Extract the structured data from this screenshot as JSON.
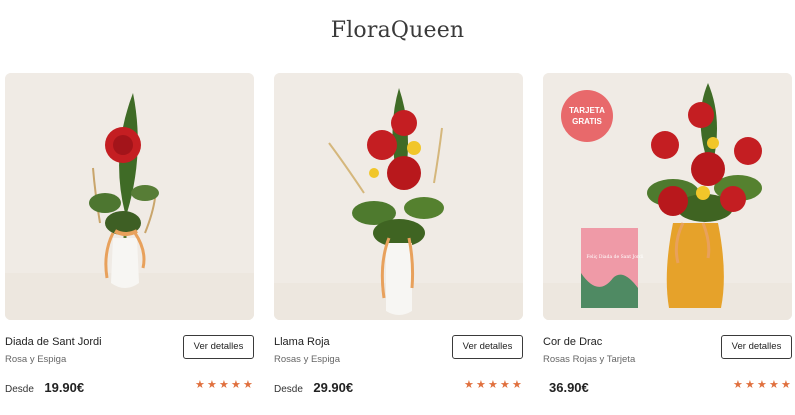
{
  "brand": {
    "logo_text": "FloraQueen",
    "accent_color": "#e0703e"
  },
  "products": [
    {
      "name": "Diada de Sant Jordi",
      "subtitle": "Rosa y Espiga",
      "button_label": "Ver detalles",
      "price_prefix": "Desde",
      "price": "19.90€",
      "rating_stars": 5,
      "badge": null
    },
    {
      "name": "Llama Roja",
      "subtitle": "Rosas y Espiga",
      "button_label": "Ver detalles",
      "price_prefix": "Desde",
      "price": "29.90€",
      "rating_stars": 5,
      "badge": null
    },
    {
      "name": "Cor de Drac",
      "subtitle": "Rosas Rojas y Tarjeta",
      "button_label": "Ver detalles",
      "price_prefix": "",
      "price": "36.90€",
      "rating_stars": 5,
      "badge": {
        "line1": "TARJETA",
        "line2": "GRATIS"
      },
      "card_text": "Feliç Diada de Sant Jordi"
    }
  ]
}
